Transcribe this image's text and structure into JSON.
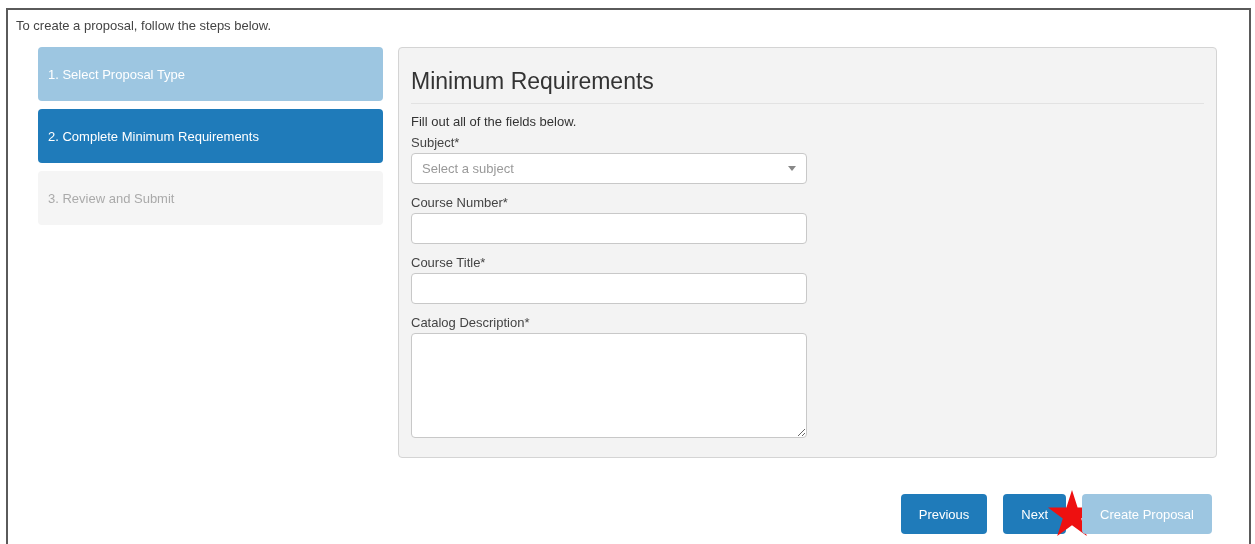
{
  "intro": "To create a proposal, follow the steps below.",
  "steps": [
    {
      "label": "1. Select Proposal Type",
      "completed": true,
      "selected": false,
      "disabled": false
    },
    {
      "label": "2. Complete Minimum Requirements",
      "completed": false,
      "selected": true,
      "disabled": false
    },
    {
      "label": "3. Review and Submit",
      "completed": false,
      "selected": false,
      "disabled": true
    }
  ],
  "panel": {
    "title": "Minimum Requirements",
    "instructions": "Fill out all of the fields below.",
    "fields": [
      {
        "kind": "select",
        "label": "Subject*",
        "placeholder": "Select a subject"
      },
      {
        "kind": "text",
        "label": "Course Number*"
      },
      {
        "kind": "text",
        "label": "Course Title*"
      },
      {
        "kind": "textarea",
        "label": "Catalog Description*"
      }
    ]
  },
  "buttons": [
    {
      "label": "Previous",
      "disabled": false,
      "starred": false
    },
    {
      "label": "Next",
      "disabled": false,
      "starred": true
    },
    {
      "label": "Create Proposal",
      "disabled": true,
      "starred": false
    }
  ]
}
